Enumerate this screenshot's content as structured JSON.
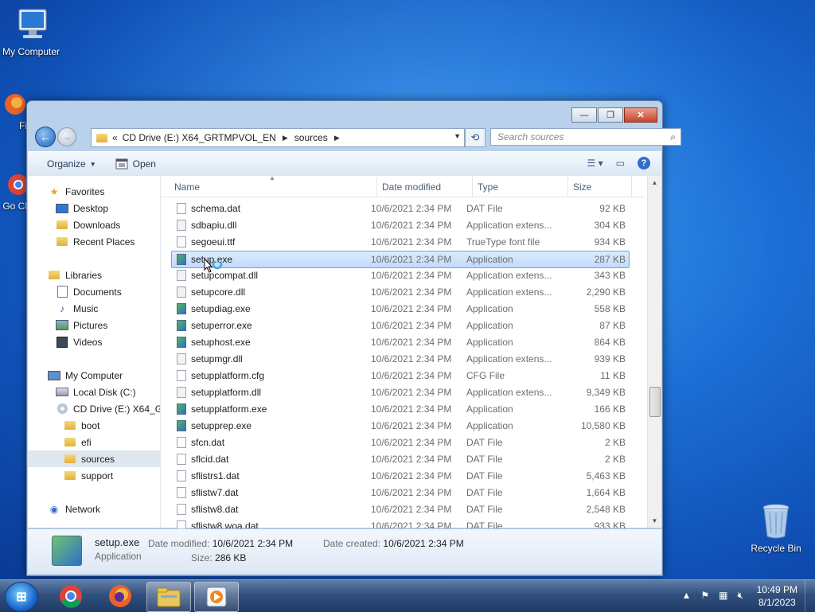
{
  "desktop": {
    "icons": [
      {
        "label": "My Computer"
      },
      {
        "label": "Fi"
      },
      {
        "label": "Go Ch"
      },
      {
        "label": "Recycle Bin"
      }
    ]
  },
  "window": {
    "controls": {
      "minimize": "—",
      "maximize": "❐",
      "close": "✕"
    },
    "address": {
      "prefix": "«",
      "segments": [
        "CD Drive (E:) X64_GRTMPVOL_EN",
        "sources"
      ]
    },
    "search_placeholder": "Search sources",
    "toolbar": {
      "organize": "Organize",
      "open": "Open"
    },
    "nav": [
      {
        "label": "Favorites",
        "icon": "star-icon"
      },
      {
        "label": "Desktop",
        "icon": "desktop-icon"
      },
      {
        "label": "Downloads",
        "icon": "downloads-icon"
      },
      {
        "label": "Recent Places",
        "icon": "recent-places-icon"
      },
      {
        "label": "Libraries",
        "icon": "libraries-icon"
      },
      {
        "label": "Documents",
        "icon": "documents-icon"
      },
      {
        "label": "Music",
        "icon": "music-icon"
      },
      {
        "label": "Pictures",
        "icon": "pictures-icon"
      },
      {
        "label": "Videos",
        "icon": "videos-icon"
      },
      {
        "label": "My Computer",
        "icon": "computer-icon"
      },
      {
        "label": "Local Disk (C:)",
        "icon": "disk-icon"
      },
      {
        "label": "CD Drive (E:) X64_GR",
        "icon": "cd-drive-icon"
      },
      {
        "label": "boot",
        "icon": "folder-icon"
      },
      {
        "label": "efi",
        "icon": "folder-icon"
      },
      {
        "label": "sources",
        "icon": "folder-icon"
      },
      {
        "label": "support",
        "icon": "folder-icon"
      },
      {
        "label": "Network",
        "icon": "network-icon"
      }
    ],
    "columns": {
      "name": "Name",
      "date": "Date modified",
      "type": "Type",
      "size": "Size"
    },
    "files": [
      {
        "name": "schema.dat",
        "date": "10/6/2021 2:34 PM",
        "type": "DAT File",
        "size": "92 KB"
      },
      {
        "name": "sdbapiu.dll",
        "date": "10/6/2021 2:34 PM",
        "type": "Application extens...",
        "size": "304 KB"
      },
      {
        "name": "segoeui.ttf",
        "date": "10/6/2021 2:34 PM",
        "type": "TrueType font file",
        "size": "934 KB"
      },
      {
        "name": "setup.exe",
        "date": "10/6/2021 2:34 PM",
        "type": "Application",
        "size": "287 KB"
      },
      {
        "name": "setupcompat.dll",
        "date": "10/6/2021 2:34 PM",
        "type": "Application extens...",
        "size": "343 KB"
      },
      {
        "name": "setupcore.dll",
        "date": "10/6/2021 2:34 PM",
        "type": "Application extens...",
        "size": "2,290 KB"
      },
      {
        "name": "setupdiag.exe",
        "date": "10/6/2021 2:34 PM",
        "type": "Application",
        "size": "558 KB"
      },
      {
        "name": "setuperror.exe",
        "date": "10/6/2021 2:34 PM",
        "type": "Application",
        "size": "87 KB"
      },
      {
        "name": "setuphost.exe",
        "date": "10/6/2021 2:34 PM",
        "type": "Application",
        "size": "864 KB"
      },
      {
        "name": "setupmgr.dll",
        "date": "10/6/2021 2:34 PM",
        "type": "Application extens...",
        "size": "939 KB"
      },
      {
        "name": "setupplatform.cfg",
        "date": "10/6/2021 2:34 PM",
        "type": "CFG File",
        "size": "11 KB"
      },
      {
        "name": "setupplatform.dll",
        "date": "10/6/2021 2:34 PM",
        "type": "Application extens...",
        "size": "9,349 KB"
      },
      {
        "name": "setupplatform.exe",
        "date": "10/6/2021 2:34 PM",
        "type": "Application",
        "size": "166 KB"
      },
      {
        "name": "setupprep.exe",
        "date": "10/6/2021 2:34 PM",
        "type": "Application",
        "size": "10,580 KB"
      },
      {
        "name": "sfcn.dat",
        "date": "10/6/2021 2:34 PM",
        "type": "DAT File",
        "size": "2 KB"
      },
      {
        "name": "sflcid.dat",
        "date": "10/6/2021 2:34 PM",
        "type": "DAT File",
        "size": "2 KB"
      },
      {
        "name": "sflistrs1.dat",
        "date": "10/6/2021 2:34 PM",
        "type": "DAT File",
        "size": "5,463 KB"
      },
      {
        "name": "sflistw7.dat",
        "date": "10/6/2021 2:34 PM",
        "type": "DAT File",
        "size": "1,664 KB"
      },
      {
        "name": "sflistw8.dat",
        "date": "10/6/2021 2:34 PM",
        "type": "DAT File",
        "size": "2,548 KB"
      },
      {
        "name": "sflistw8.woa.dat",
        "date": "10/6/2021 2:34 PM",
        "type": "DAT File",
        "size": "933 KB"
      }
    ],
    "selected_index": 3,
    "details": {
      "name": "setup.exe",
      "type": "Application",
      "date_modified_label": "Date modified:",
      "date_modified": "10/6/2021 2:34 PM",
      "date_created_label": "Date created:",
      "date_created": "10/6/2021 2:34 PM",
      "size_label": "Size:",
      "size": "286 KB"
    }
  },
  "taskbar": {
    "clock_time": "10:49 PM",
    "clock_date": "8/1/2023",
    "apps": [
      "chrome-icon",
      "firefox-icon",
      "explorer-icon",
      "media-player-icon"
    ]
  }
}
